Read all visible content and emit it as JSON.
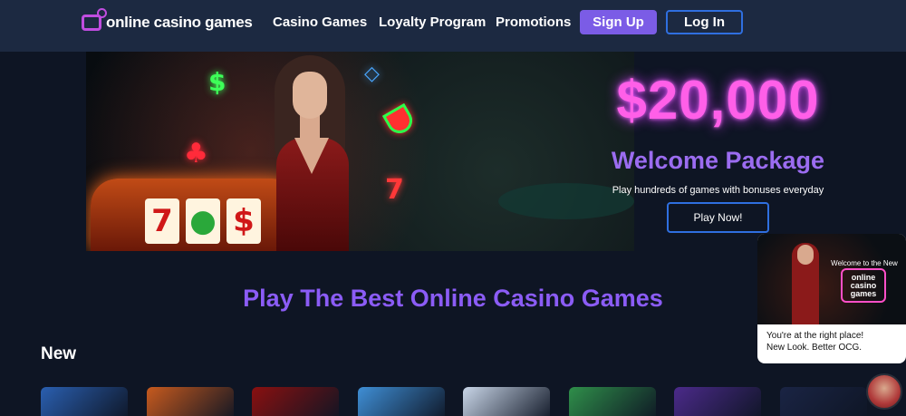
{
  "header": {
    "logo_text": "online casino games",
    "nav": [
      "Casino Games",
      "Loyalty Program",
      "Promotions"
    ],
    "signup_label": "Sign Up",
    "login_label": "Log In"
  },
  "hero": {
    "amount": "$20,000",
    "subtitle": "Welcome Package",
    "description": "Play hundreds of games with bonuses everyday",
    "cta_label": "Play Now!"
  },
  "main": {
    "section_title": "Play The Best Online Casino Games",
    "new_label": "New",
    "game_tiles": [
      {
        "icon": "game-thumbnail-icon",
        "color": "#2a5fb0"
      },
      {
        "icon": "game-thumbnail-icon",
        "color": "#c75a1e"
      },
      {
        "icon": "game-thumbnail-icon",
        "color": "#8a1010"
      },
      {
        "icon": "game-thumbnail-icon",
        "color": "#3f8fd6"
      },
      {
        "icon": "game-thumbnail-icon",
        "color": "#c9d6e8"
      },
      {
        "icon": "game-thumbnail-icon",
        "color": "#2f8f4a"
      },
      {
        "icon": "game-thumbnail-icon",
        "color": "#4b2a8a"
      },
      {
        "icon": "game-thumbnail-icon",
        "color": "#1a2444"
      }
    ]
  },
  "popup": {
    "welcome_text": "Welcome to the New",
    "logo_text": "online casino games",
    "line1": "You're at the right place!",
    "line2": "New Look. Better OCG."
  },
  "colors": {
    "header_bg": "#1c2941",
    "page_bg": "#0e1524",
    "accent_purple": "#7b5ce6",
    "accent_pink": "#ff5fe8",
    "button_border": "#2f6fe0"
  }
}
